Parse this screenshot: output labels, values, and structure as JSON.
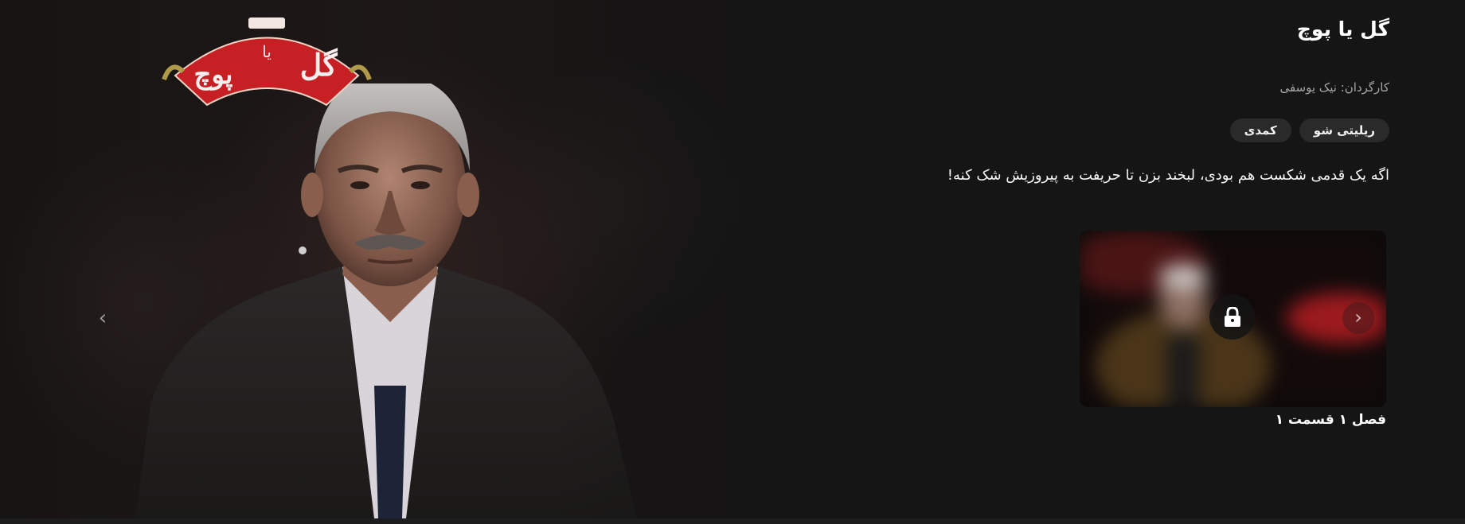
{
  "show": {
    "title": "گل یا پوچ",
    "director_label": "کارگردان:",
    "director_name": "نیک یوسفی",
    "genres": [
      "ریلیتی شو",
      "کمدی"
    ],
    "tagline": "اگه یک قدمی شکست هم بودی، لبخند بزن تا حریفت به پیروزیش شک کنه!"
  },
  "logo": {
    "text_main": "گل",
    "text_mid": "یا",
    "text_right": "پوچ",
    "color": "#c61f24"
  },
  "episode": {
    "label": "فصل ۱ قسمت ۱",
    "locked": true
  },
  "icons": {
    "prev": "chevron-left-icon",
    "next": "chevron-right-icon",
    "lock": "lock-icon"
  }
}
